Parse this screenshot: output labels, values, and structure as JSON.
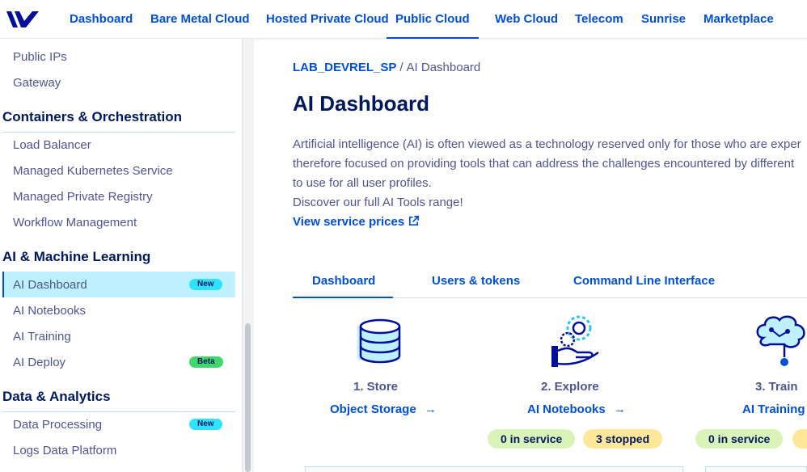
{
  "nav": {
    "items": [
      {
        "label": "Dashboard"
      },
      {
        "label": "Bare Metal Cloud"
      },
      {
        "label": "Hosted Private Cloud"
      },
      {
        "label": "Public Cloud"
      },
      {
        "label": "Web Cloud"
      },
      {
        "label": "Telecom"
      },
      {
        "label": "Sunrise"
      },
      {
        "label": "Marketplace"
      }
    ],
    "active": "Public Cloud"
  },
  "sidebar": {
    "network_items": [
      {
        "label": "Public IPs"
      },
      {
        "label": "Gateway"
      }
    ],
    "sections": [
      {
        "title": "Containers & Orchestration",
        "items": [
          {
            "label": "Load Balancer"
          },
          {
            "label": "Managed Kubernetes Service"
          },
          {
            "label": "Managed Private Registry"
          },
          {
            "label": "Workflow Management"
          }
        ]
      },
      {
        "title": "AI & Machine Learning",
        "items": [
          {
            "label": "AI Dashboard",
            "badge": "New",
            "active": true
          },
          {
            "label": "AI Notebooks"
          },
          {
            "label": "AI Training"
          },
          {
            "label": "AI Deploy",
            "badge": "Beta"
          }
        ]
      },
      {
        "title": "Data & Analytics",
        "items": [
          {
            "label": "Data Processing",
            "badge": "New"
          },
          {
            "label": "Logs Data Platform"
          }
        ]
      }
    ]
  },
  "breadcrumb": {
    "project": "LAB_DEVREL_SP",
    "separator": "/",
    "current": "AI Dashboard"
  },
  "page": {
    "title": "AI Dashboard",
    "description_lines": [
      "Artificial intelligence (AI) is often viewed as a technology reserved only for those who are exper",
      "therefore focused on providing tools that can address the challenges encountered by different",
      "to use for all user profiles.",
      "Discover our full AI Tools range!"
    ],
    "prices_link": "View service prices",
    "prices_icon": "external-link-icon"
  },
  "tabs": [
    {
      "label": "Dashboard",
      "active": true
    },
    {
      "label": "Users & tokens"
    },
    {
      "label": "Command Line Interface"
    }
  ],
  "steps": [
    {
      "icon": "database-icon",
      "label": "1. Store",
      "link": "Object Storage",
      "arrow": "→"
    },
    {
      "icon": "hand-gears-icon",
      "label": "2. Explore",
      "link": "AI Notebooks",
      "arrow": "→",
      "status": [
        {
          "text": "0 in service",
          "tone": "green"
        },
        {
          "text": "3 stopped",
          "tone": "yellow"
        }
      ]
    },
    {
      "icon": "brain-circuit-icon",
      "label": "3. Train",
      "link": "AI Training",
      "status": [
        {
          "text": "0 in service",
          "tone": "green"
        }
      ]
    }
  ],
  "colors": {
    "brand_blue": "#0050d7",
    "heading_navy": "#00185e",
    "text": "#4d5693",
    "active_bg": "#bef1ff",
    "badge_new": "#2ee3ff",
    "badge_beta": "#3fd96b",
    "pill_green": "#d9f3b9",
    "pill_yellow": "#ffe79a"
  }
}
